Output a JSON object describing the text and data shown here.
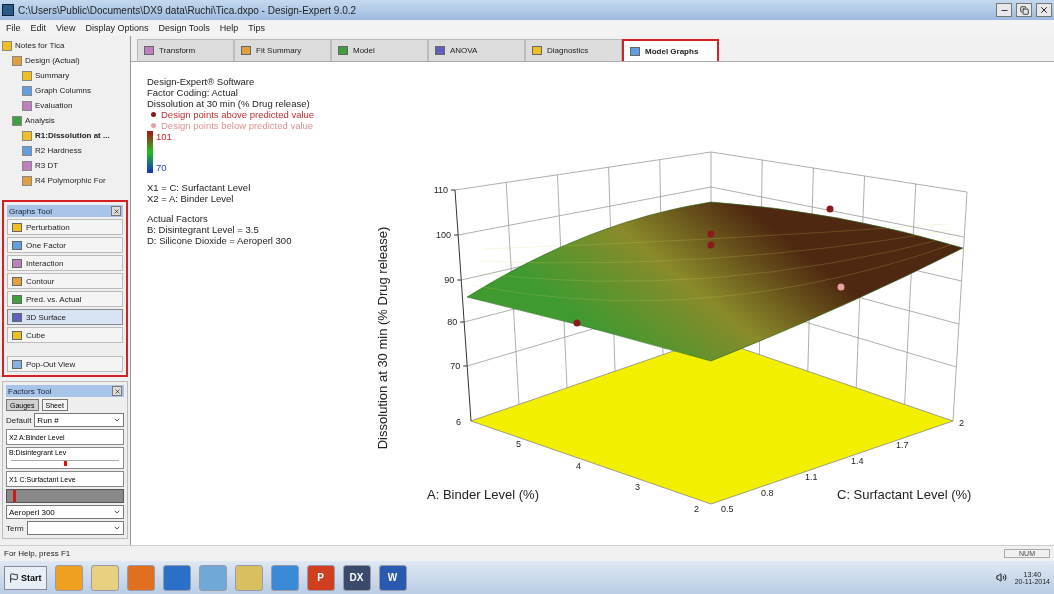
{
  "window": {
    "title": "C:\\Users\\Public\\Documents\\DX9 data\\Ruchi\\Tica.dxpo - Design-Expert 9.0.2"
  },
  "menu": [
    "File",
    "Edit",
    "View",
    "Display Options",
    "Design Tools",
    "Help",
    "Tips"
  ],
  "tree": [
    {
      "label": "Notes for Tica",
      "selected": false,
      "children": [
        {
          "label": "Design (Actual)",
          "selected": false,
          "children": [
            {
              "label": "Summary",
              "selected": false
            },
            {
              "label": "Graph Columns",
              "selected": false
            },
            {
              "label": "Evaluation",
              "selected": false
            }
          ]
        },
        {
          "label": "Analysis",
          "selected": false,
          "children": [
            {
              "label": "R1:Dissolution at ...",
              "selected": true
            },
            {
              "label": "R2 Hardness",
              "selected": false
            },
            {
              "label": "R3 DT",
              "selected": false
            },
            {
              "label": "R4 Polymorphic For",
              "selected": false
            }
          ]
        }
      ]
    }
  ],
  "graphs_tool": {
    "title": "Graphs Tool",
    "highlighted": true,
    "buttons": [
      {
        "label": "Perturbation",
        "selected": false
      },
      {
        "label": "One Factor",
        "selected": false
      },
      {
        "label": "Interaction",
        "selected": false
      },
      {
        "label": "Contour",
        "selected": false
      },
      {
        "label": "Pred. vs. Actual",
        "selected": false
      },
      {
        "label": "3D Surface",
        "selected": true
      },
      {
        "label": "Cube",
        "selected": false
      }
    ],
    "popout": "Pop-Out View"
  },
  "factors_tool": {
    "title": "Factors Tool",
    "tabs": [
      {
        "label": "Gauges",
        "selected": true
      },
      {
        "label": "Sheet",
        "selected": false
      }
    ],
    "default_label": "Default",
    "run_select": "Run #",
    "factors": [
      {
        "kind": "label",
        "text": "X2 A:Binder Level"
      },
      {
        "kind": "slider",
        "text": "B:Disintegrant Lev",
        "level": 0.5
      },
      {
        "kind": "label",
        "text": "X1 C:Surfactant Leve"
      },
      {
        "kind": "bar",
        "level": 0.05
      }
    ],
    "category_select": "Aeroperl 300",
    "term_label": "Term"
  },
  "tabs": [
    {
      "label": "Transform",
      "selected": false,
      "highlighted": false
    },
    {
      "label": "Fit Summary",
      "selected": false,
      "highlighted": false
    },
    {
      "label": "Model",
      "selected": false,
      "highlighted": false
    },
    {
      "label": "ANOVA",
      "selected": false,
      "highlighted": false
    },
    {
      "label": "Diagnostics",
      "selected": false,
      "highlighted": false
    },
    {
      "label": "Model Graphs",
      "selected": true,
      "highlighted": true
    }
  ],
  "legend": {
    "lines": [
      "Design-Expert® Software",
      "Factor Coding: Actual",
      "Dissolution at 30 min (% Drug release)"
    ],
    "points": [
      {
        "label": "Design points above predicted value",
        "color": "#8b1a1a"
      },
      {
        "label": "Design points below predicted value",
        "color": "#e8a0a0"
      }
    ],
    "scale_high": "101",
    "scale_low": "70",
    "factors": [
      "X1 = C: Surfactant Level",
      "X2 = A: Binder Level"
    ],
    "actual_heading": "Actual Factors",
    "actual": [
      "B: Disintegrant Level = 3.5",
      "D: Silicone Dioxide = Aeroperl 300"
    ]
  },
  "plot": {
    "z_title": "Dissolution at 30 min (% Drug release)",
    "z_ticks": [
      "110",
      "100",
      "90",
      "80",
      "70"
    ],
    "a_title": "A: Binder Level (%)",
    "a_ticks": [
      "6",
      "5",
      "4",
      "3",
      "2"
    ],
    "c_title": "C: Surfactant Level (%)",
    "c_ticks": [
      "0.5",
      "0.8",
      "1.1",
      "1.4",
      "1.7",
      "2"
    ]
  },
  "status_bar": {
    "help": "For Help, press F1",
    "num": "NUM"
  },
  "taskbar": {
    "start": "Start",
    "apps": [
      {
        "kind": "outlook"
      },
      {
        "kind": "folder"
      },
      {
        "kind": "media"
      },
      {
        "kind": "browser"
      },
      {
        "kind": "document"
      },
      {
        "kind": "explorer"
      },
      {
        "kind": "globe"
      },
      {
        "kind": "slides",
        "letter": "P"
      },
      {
        "kind": "dx",
        "letter": "DX"
      },
      {
        "kind": "word",
        "letter": "W"
      }
    ],
    "time": "13:40",
    "date": "20-11-2014"
  }
}
